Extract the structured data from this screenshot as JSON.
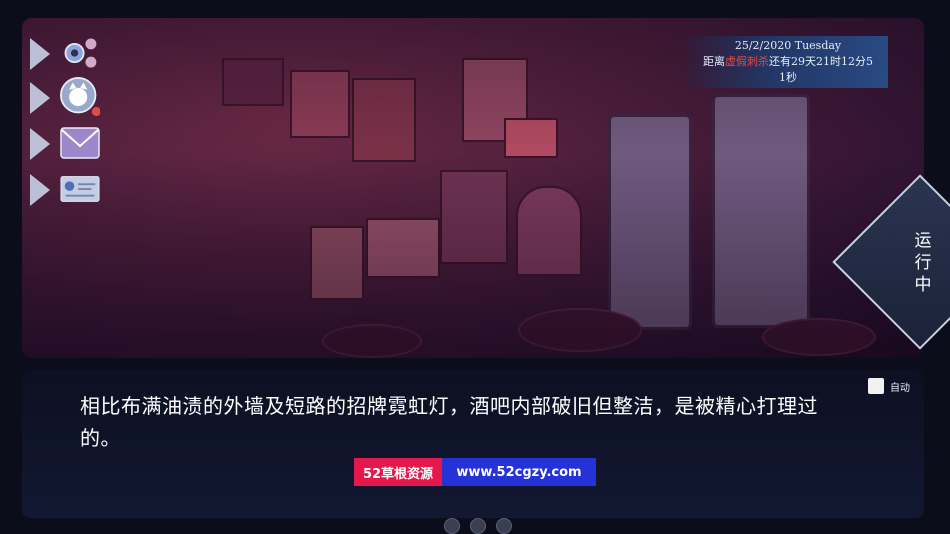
{
  "time_panel": {
    "date_line": "25/2/2020  Tuesday",
    "countdown_prefix": "距离",
    "countdown_event": "虚假刺杀",
    "countdown_suffix": "还有29天21时12分5",
    "countdown_seconds": "1秒"
  },
  "status": {
    "label": "运行中"
  },
  "side_nav": {
    "items": [
      {
        "name": "settings",
        "icon": "gear-icon"
      },
      {
        "name": "character",
        "icon": "cat-avatar-icon"
      },
      {
        "name": "messages",
        "icon": "mail-icon"
      },
      {
        "name": "id-card",
        "icon": "card-icon"
      }
    ]
  },
  "dialog": {
    "text": "相比布满油渍的外墙及短路的招牌霓虹灯，酒吧内部破旧但整洁，是被精心打理过的。"
  },
  "auto": {
    "label": "自动"
  },
  "watermark": {
    "left": "52草根资源",
    "right": "www.52cgzy.com"
  },
  "colors": {
    "accent_red": "#e24a4a",
    "watermark_red": "#e5184c",
    "watermark_blue": "#2432d8"
  }
}
